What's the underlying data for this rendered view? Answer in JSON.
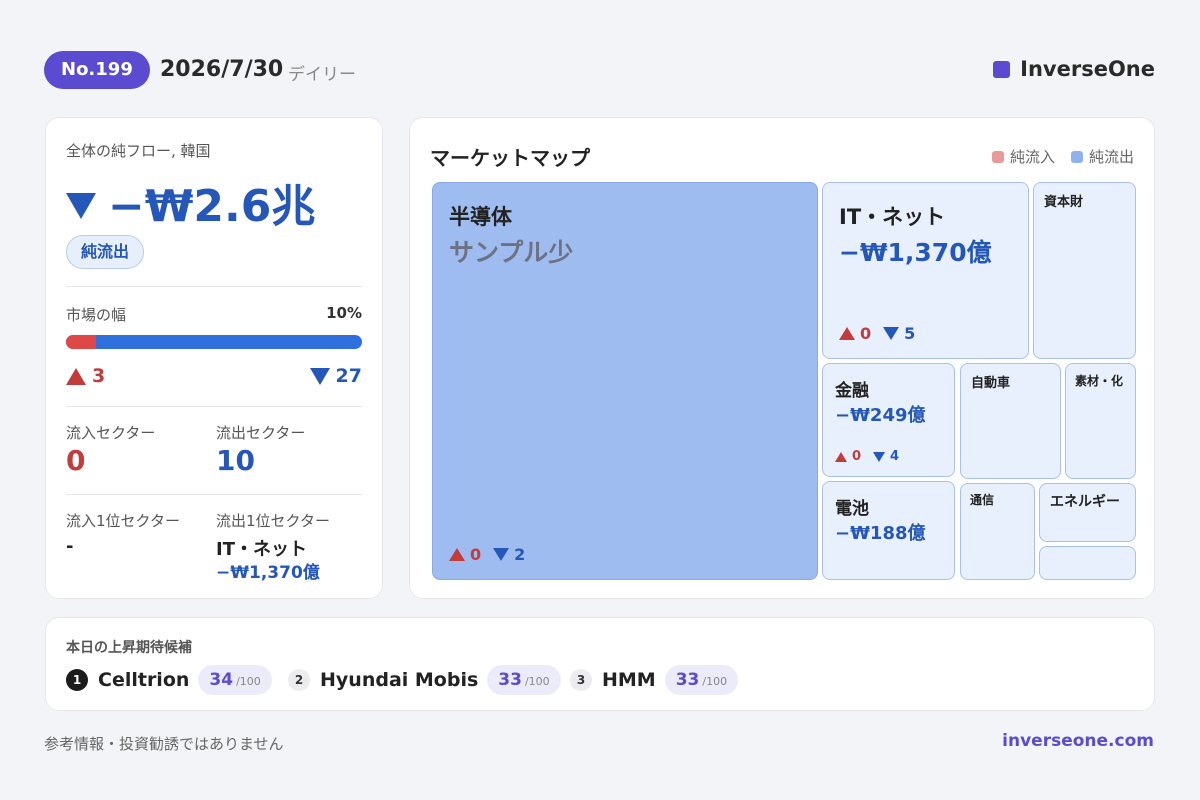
{
  "header": {
    "issue": "No.199",
    "date": "2026/7/30",
    "frequency": "デイリー",
    "brand": "InverseOne",
    "brand_color": "#5a4bd1"
  },
  "summary": {
    "title": "全体の純フロー, 韓国",
    "net_flow": "−₩2.6兆",
    "direction_badge": "純流出",
    "breadth_label": "市場の幅",
    "breadth_pct": "10%",
    "breadth_fraction": 0.1,
    "advancers": "3",
    "decliners": "27",
    "inflow_sectors_label": "流入セクター",
    "inflow_sectors": "0",
    "outflow_sectors_label": "流出セクター",
    "outflow_sectors": "10",
    "top_inflow_label": "流入1位セクター",
    "top_inflow_name": "-",
    "top_outflow_label": "流出1位セクター",
    "top_outflow_name": "IT・ネット",
    "top_outflow_value": "−₩1,370億"
  },
  "market_map": {
    "title": "マーケットマップ",
    "legend_inflow": "純流入",
    "legend_outflow": "純流出",
    "inflow_color": "#e89a9a",
    "outflow_color": "#8fb2ec",
    "tiles": {
      "semis": {
        "name": "半導体",
        "value": "サンプル少",
        "up": "0",
        "down": "2"
      },
      "it": {
        "name": "IT・ネット",
        "value": "−₩1,370億",
        "up": "0",
        "down": "5"
      },
      "capital": {
        "name": "資本財"
      },
      "finance": {
        "name": "金融",
        "value": "−₩249億",
        "up": "0",
        "down": "4"
      },
      "auto": {
        "name": "自動車"
      },
      "materials": {
        "name": "素材・化"
      },
      "battery": {
        "name": "電池",
        "value": "−₩188億"
      },
      "telecom": {
        "name": "通信"
      },
      "energy": {
        "name": "エネルギー"
      }
    }
  },
  "picks": {
    "title": "本日の上昇期待候補",
    "score_max": "/100",
    "items": [
      {
        "rank": "1",
        "name": "Celltrion",
        "score": "34"
      },
      {
        "rank": "2",
        "name": "Hyundai Mobis",
        "score": "33"
      },
      {
        "rank": "3",
        "name": "HMM",
        "score": "33"
      }
    ]
  },
  "footer": {
    "disclaimer": "参考情報・投資勧誘ではありません",
    "site": "inverseone.com"
  }
}
